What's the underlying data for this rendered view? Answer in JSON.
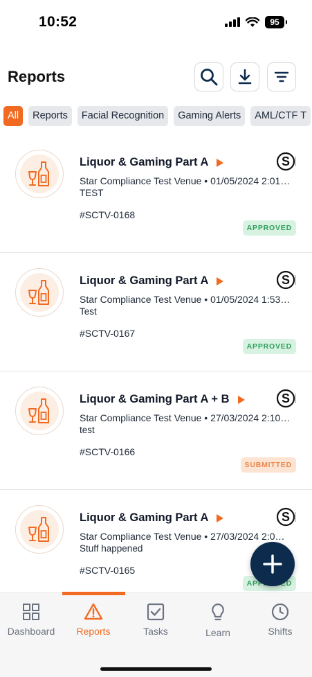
{
  "status_bar": {
    "time": "10:52",
    "battery": "95"
  },
  "header": {
    "title": "Reports"
  },
  "filters": [
    {
      "label": "All",
      "active": true
    },
    {
      "label": "Reports",
      "active": false
    },
    {
      "label": "Facial Recognition",
      "active": false
    },
    {
      "label": "Gaming Alerts",
      "active": false
    },
    {
      "label": "AML/CTF T",
      "active": false
    }
  ],
  "reports": [
    {
      "title": "Liquor & Gaming Part A",
      "meta": "Star Compliance Test Venue • 01/05/2024 2:01…",
      "description": "TEST",
      "id": "#SCTV-0168",
      "status": "APPROVED"
    },
    {
      "title": "Liquor & Gaming Part A",
      "meta": "Star Compliance Test Venue • 01/05/2024 1:53…",
      "description": "Test",
      "id": "#SCTV-0167",
      "status": "APPROVED"
    },
    {
      "title": "Liquor & Gaming Part A + B",
      "meta": "Star Compliance Test Venue • 27/03/2024 2:10…",
      "description": "test",
      "id": "#SCTV-0166",
      "status": "SUBMITTED"
    },
    {
      "title": "Liquor & Gaming Part A",
      "meta": "Star Compliance Test Venue • 27/03/2024 2:0…",
      "description": "Stuff happened",
      "id": "#SCTV-0165",
      "status": "APPROVED"
    }
  ],
  "tabs": [
    {
      "label": "Dashboard",
      "icon": "grid-icon"
    },
    {
      "label": "Reports",
      "icon": "warning-triangle-icon"
    },
    {
      "label": "Tasks",
      "icon": "checkbox-icon"
    },
    {
      "label": "Learn",
      "icon": "lightbulb-icon"
    },
    {
      "label": "Shifts",
      "icon": "clock-icon"
    }
  ],
  "colors": {
    "accent": "#f26a21",
    "navy": "#0d2b4d",
    "approved_bg": "#d7f2e1",
    "approved_text": "#2e9e5b",
    "submitted_bg": "#fde3d2",
    "submitted_text": "#e7894f"
  }
}
